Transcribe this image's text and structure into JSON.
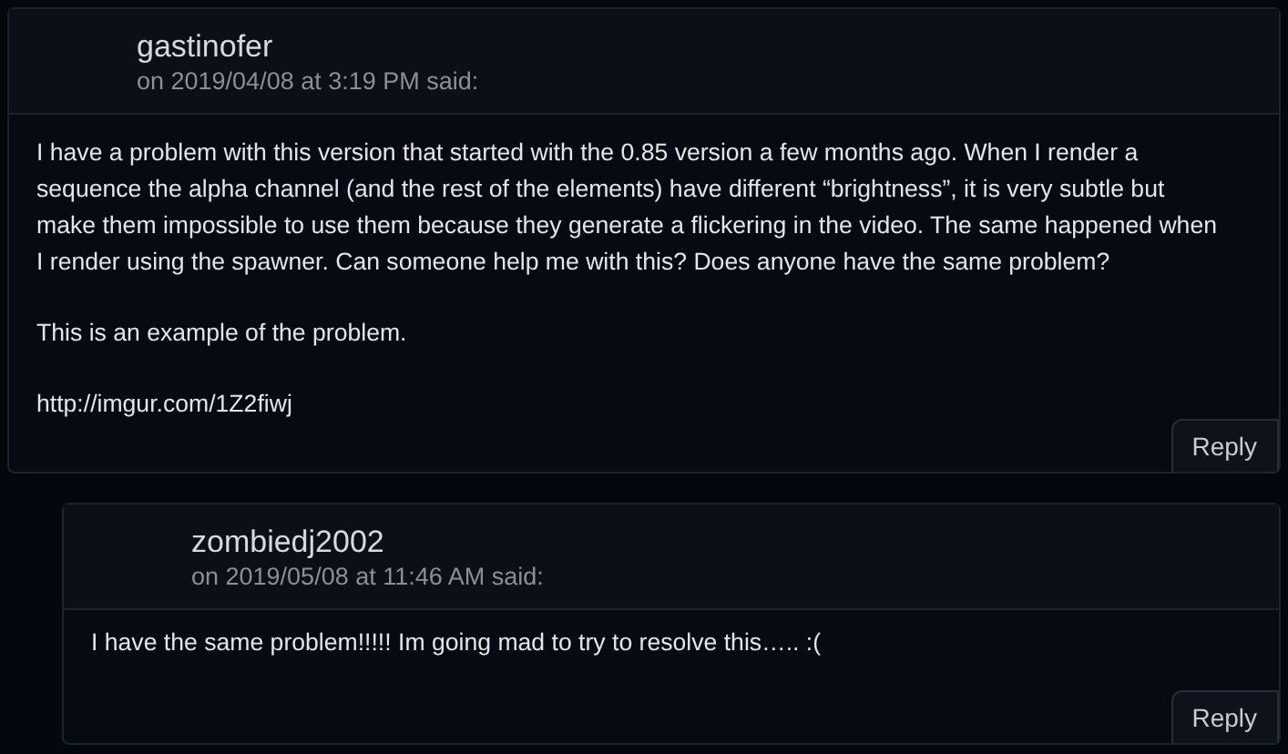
{
  "comments": [
    {
      "author": "gastinofer",
      "date": "on 2019/04/08 at 3:19 PM said:",
      "paragraphs": [
        "I have a problem with this version that started with the 0.85 version a few months ago. When I render a sequence the alpha channel (and the rest of the elements) have different “brightness”, it is very subtle but make them impossible to use them because they generate a flickering in the video. The same happened when I render using the spawner. Can someone help me with this? Does anyone have the same problem?",
        "This is an example of the problem.",
        "http://imgur.com/1Z2fiwj"
      ],
      "reply": "Reply",
      "children": [
        {
          "author": "zombiedj2002",
          "date": "on 2019/05/08 at 11:46 AM said:",
          "paragraphs": [
            "I have the same problem!!!!! Im going mad to try to resolve this….. :("
          ],
          "reply": "Reply"
        }
      ]
    }
  ]
}
